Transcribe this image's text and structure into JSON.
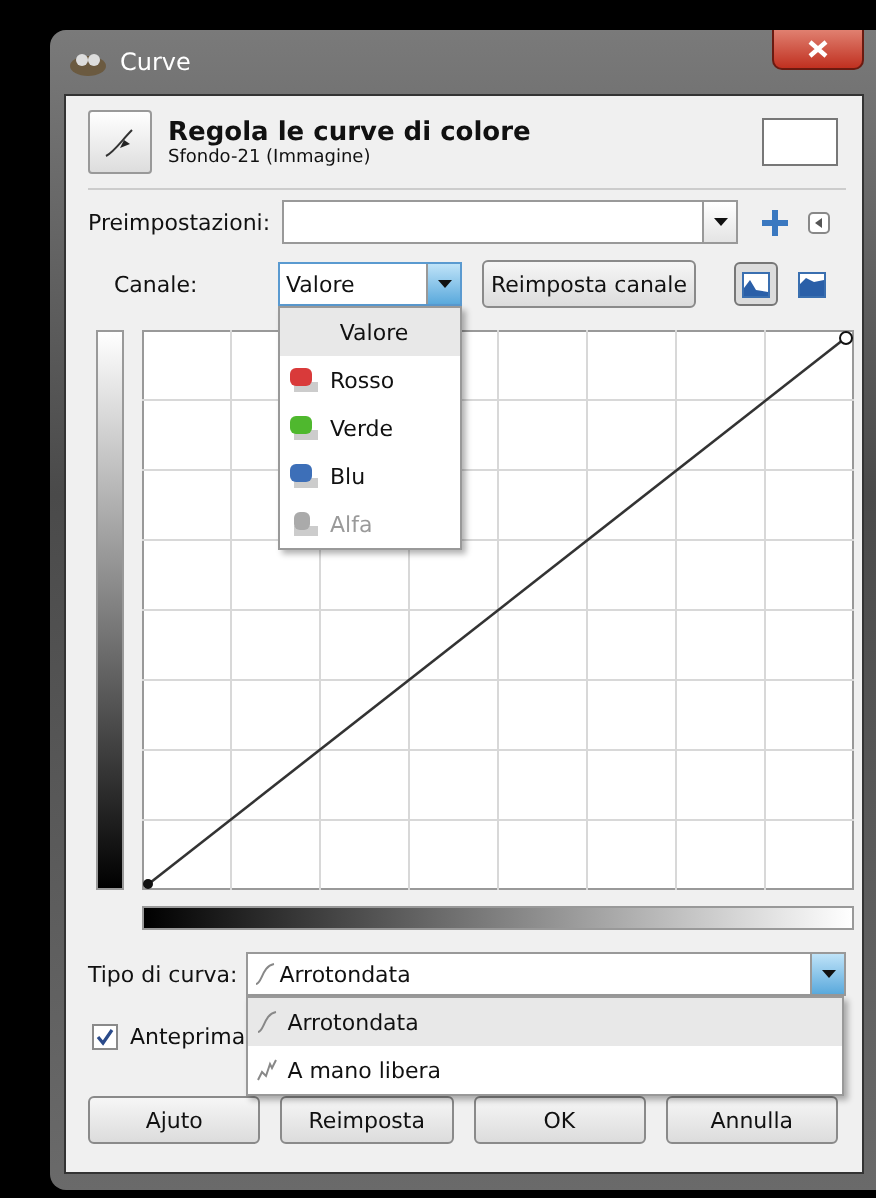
{
  "window": {
    "title": "Curve"
  },
  "header": {
    "title": "Regola le curve di colore",
    "subtitle": "Sfondo-21 (Immagine)"
  },
  "presets": {
    "label": "Preimpostazioni:"
  },
  "channel": {
    "label": "Canale:",
    "value": "Valore",
    "reset_button": "Reimposta canale",
    "expanded": true,
    "options": [
      {
        "label": "Valore",
        "kind": "plain",
        "selected": true,
        "disabled": false
      },
      {
        "label": "Rosso",
        "kind": "swatch",
        "color": "#d93a3a",
        "selected": false,
        "disabled": false
      },
      {
        "label": "Verde",
        "kind": "swatch",
        "color": "#4fb82e",
        "selected": false,
        "disabled": false
      },
      {
        "label": "Blu",
        "kind": "swatch",
        "color": "#3d6fb8",
        "selected": false,
        "disabled": false
      },
      {
        "label": "Alfa",
        "kind": "alpha",
        "selected": false,
        "disabled": true
      }
    ],
    "scale_buttons": [
      {
        "kind": "linear",
        "selected": true
      },
      {
        "kind": "log",
        "selected": false
      }
    ]
  },
  "curve_type": {
    "label": "Tipo di curva:",
    "value": "Arrotondata",
    "expanded": true,
    "options": [
      {
        "label": "Arrotondata",
        "selected": true
      },
      {
        "label": "A mano libera",
        "selected": false
      }
    ]
  },
  "preview": {
    "label": "Anteprima",
    "checked": true
  },
  "buttons": [
    "Ajuto",
    "Reimposta",
    "OK",
    "Annulla"
  ]
}
